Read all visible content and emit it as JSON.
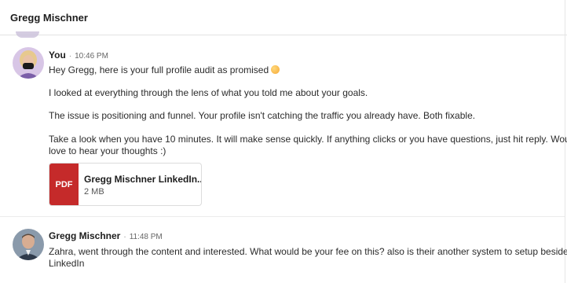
{
  "conversation": {
    "title": "Gregg Mischner"
  },
  "messages": [
    {
      "author": "You",
      "time": "10:46 PM",
      "lines": [
        "Hey Gregg, here is your full profile audit as promised",
        "I looked at everything through the lens of what you told me about your goals.",
        "The issue is positioning and funnel. Your profile isn't catching the traffic you already have. Both fixable.",
        "Take a look when you have 10 minutes. It will make sense quickly. If anything clicks or you have questions, just hit reply. Would",
        "love to hear your thoughts :)"
      ],
      "emoji": "smiling-face-icon",
      "attachment": {
        "type": "PDF",
        "name": "Gregg Mischner LinkedIn...",
        "size": "2 MB"
      }
    },
    {
      "author": "Gregg Mischner",
      "time": "11:48 PM",
      "lines": [
        "Zahra, went through the content and interested. What would be your fee on this? also is their another system to setup besides",
        "LinkedIn"
      ]
    }
  ],
  "colors": {
    "pdf_badge": "#c52a2a",
    "divider": "#e3e3e3"
  },
  "meta_separator": "·"
}
